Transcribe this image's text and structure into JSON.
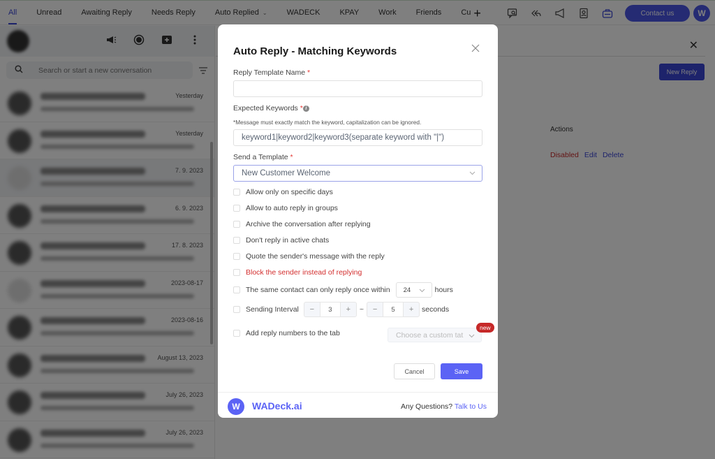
{
  "topbar": {
    "tabs": [
      {
        "label": "All",
        "active": true
      },
      {
        "label": "Unread"
      },
      {
        "label": "Awaiting Reply"
      },
      {
        "label": "Needs Reply"
      },
      {
        "label": "Auto Replied",
        "dropdown": true
      },
      {
        "label": "WADECK"
      },
      {
        "label": "KPAY"
      },
      {
        "label": "Work"
      },
      {
        "label": "Friends"
      },
      {
        "label": "Cu"
      }
    ],
    "add_tab_label": "+",
    "icons": [
      "chat-search-icon",
      "reply-all-icon",
      "megaphone-icon",
      "contact-card-icon",
      "toolbox-icon",
      "alarm-clock-icon"
    ],
    "contact_label": "Contact us",
    "avatar_letter": "W"
  },
  "left_panel": {
    "search_placeholder": "Search or start a new conversation",
    "conversations": [
      {
        "time": "Yesterday"
      },
      {
        "time": "Yesterday"
      },
      {
        "time": "7. 9. 2023",
        "selected": true
      },
      {
        "time": "6. 9. 2023"
      },
      {
        "time": "17. 8. 2023"
      },
      {
        "time": "2023-08-17"
      },
      {
        "time": "2023-08-16"
      },
      {
        "time": "August 13, 2023"
      },
      {
        "time": "July 26, 2023"
      },
      {
        "time": "July 26, 2023"
      }
    ]
  },
  "right_panel": {
    "new_reply_label": "New Reply",
    "actions_header": "Actions",
    "row_status": "Disabled",
    "row_edit": "Edit",
    "row_delete": "Delete"
  },
  "modal": {
    "title": "Auto Reply - Matching Keywords",
    "name_label": "Reply Template Name",
    "name_value": "",
    "keywords_label": "Expected Keywords",
    "keywords_hint": "*Message must exactly match the keyword, capitalization can be ignored.",
    "keywords_placeholder": "keyword1|keyword2|keyword3(separate keyword with \"|\")",
    "template_label": "Send a Template",
    "template_value": "New Customer Welcome",
    "required_mark": "*",
    "options": [
      {
        "label": "Allow only on specific days",
        "checked": false
      },
      {
        "label": "Allow to auto reply in groups",
        "checked": false
      },
      {
        "label": "Archive the conversation after replying",
        "checked": false
      },
      {
        "label": "Don't reply in active chats",
        "checked": false
      },
      {
        "label": "Quote the sender's message with the reply",
        "checked": false
      },
      {
        "label": "Block the sender instead of replying",
        "checked": false,
        "danger": true
      }
    ],
    "once_within": {
      "label": "The same contact can only reply once within",
      "value": "24",
      "unit": "hours",
      "checked": false
    },
    "interval": {
      "label": "Sending Interval",
      "min": "3",
      "max": "5",
      "separator": "~",
      "unit": "seconds",
      "checked": false
    },
    "tab_option": {
      "label": "Add reply numbers to the tab",
      "placeholder": "Choose a custom tat",
      "badge": "new",
      "checked": false
    },
    "cancel_label": "Cancel",
    "save_label": "Save",
    "footer": {
      "brand": "WADeck.ai",
      "logo_letter": "W",
      "question": "Any Questions?",
      "talk": "Talk to Us"
    }
  },
  "colors": {
    "accent": "#5b63f5",
    "brand_dark": "#3b46d6",
    "danger": "#d32f2f",
    "overlay": "rgba(0,0,0,0.5)"
  }
}
